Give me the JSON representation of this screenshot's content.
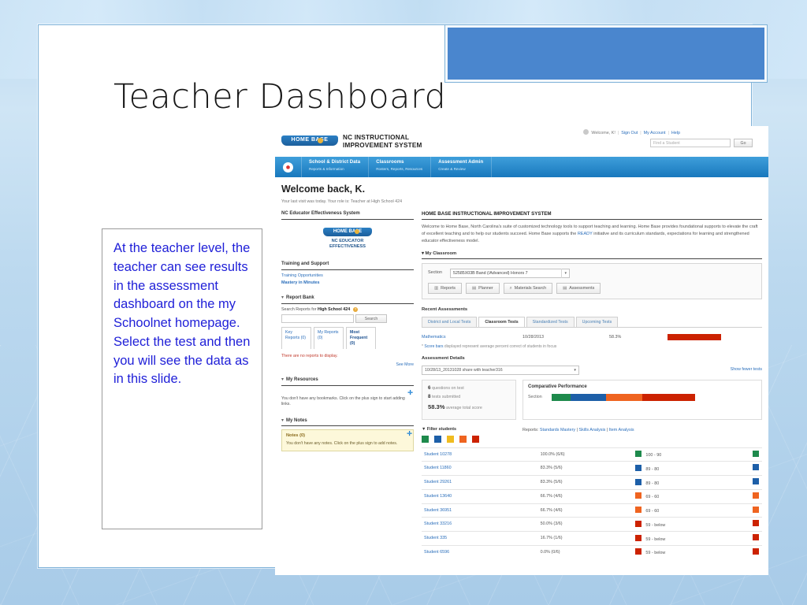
{
  "slide": {
    "title": "Teacher Dashboard",
    "caption": "At the teacher level, the teacher can see results in the assessment dashboard on the my Schoolnet homepage.\nSelect the test and then you will see the data as in this slide."
  },
  "app": {
    "brand": {
      "logo_text": "HOME BASE",
      "title_line1": "NC INSTRUCTIONAL",
      "title_line2": "IMPROVEMENT SYSTEM"
    },
    "userbar": {
      "welcome": "Welcome, K!",
      "sign_out": "Sign Out",
      "my_account": "My Account",
      "help": "Help"
    },
    "find_student": {
      "placeholder": "Find a Student",
      "go_label": "Go"
    },
    "nav": [
      {
        "title": "School & District Data",
        "subtitle": "Reports & Information"
      },
      {
        "title": "Classrooms",
        "subtitle": "Rosters, Reports, Resources"
      },
      {
        "title": "Assessment Admin",
        "subtitle": "Create & Review"
      }
    ],
    "welcome": {
      "heading": "Welcome back, K.",
      "subtext": "Your last visit was today. Your role is: Teacher at High School 424"
    },
    "left": {
      "ee_header": "NC Educator Effectiveness System",
      "ee_logo": "HOME BASE",
      "ee_sub_line1": "NC EDUCATOR",
      "ee_sub_line2": "EFFECTIVENESS",
      "training_header": "Training and Support",
      "training_links": [
        "Training Opportunities",
        "Mastery in Minutes"
      ],
      "report_bank": {
        "header": "Report Bank",
        "search_label_prefix": "Search Reports for ",
        "search_label_school": "High School 424",
        "search_button": "Search",
        "tabs": [
          "Key Reports (0)",
          "My Reports (0)",
          "Most Frequent (0)"
        ],
        "empty_message": "There are no reports to display.",
        "see_more": "See More"
      },
      "my_resources": {
        "header": "My Resources",
        "body": "You don't have any bookmarks. Click on the plus sign to start adding links."
      },
      "my_notes": {
        "header": "My Notes",
        "card_title": "Notes (0)",
        "card_body": "You don't have any notes. Click on the plus sign to add notes."
      }
    },
    "right": {
      "intro_header": "HOME BASE INSTRUCTIONAL IMPROVEMENT SYSTEM",
      "intro_body_1": "Welcome to Home Base, North Carolina's suite of customized technology tools to support teaching and learning. Home Base provides foundational supports to elevate the craft of excellent teaching and to help our students succeed. Home Base supports the ",
      "intro_link_1": "READY",
      "intro_body_2": " initiative and its curriculum standards, expectations for learning and strengthened educator effectiveness model.",
      "my_classroom": {
        "header": "My Classroom",
        "section_label": "Section",
        "section_value": "52585X03B Band (/Advanced) Honors 7",
        "buttons": [
          "Reports",
          "Planner",
          "Materials Search",
          "Assessments"
        ]
      },
      "recent_assessments": {
        "header": "Recent Assessments",
        "tabs": [
          "District and Local Tests",
          "Classroom Tests",
          "Standardized Tests",
          "Upcoming Tests"
        ],
        "active_tab": "Classroom Tests",
        "row": {
          "subject": "Mathematics",
          "date": "10/28/2013",
          "score": "58.3%",
          "bar_color": "#cc2200"
        },
        "footnote_star": "* ",
        "footnote_link": "Score bars",
        "footnote_rest": " displayed represent average percent correct of students in focus"
      },
      "assessment_details": {
        "header": "Assessment Details",
        "select_value": "10/28/13_20131028 share with teacher316",
        "show_fewer": "Show fewer tests",
        "stats": [
          {
            "value": "6",
            "label": "questions on test"
          },
          {
            "value": "8",
            "label": "tests submitted"
          },
          {
            "value": "58.3%",
            "label": "average total score"
          }
        ],
        "comparative": {
          "header": "Comparative Performance",
          "row_label": "Section",
          "segments": [
            {
              "color": "#1e8a4c",
              "pct": 13
            },
            {
              "color": "#1d5fa8",
              "pct": 25
            },
            {
              "color": "#ef6420",
              "pct": 25
            },
            {
              "color": "#cc2200",
              "pct": 37
            }
          ]
        }
      },
      "filter": {
        "label": "Filter students",
        "swatches": [
          "#1e8a4c",
          "#1d5fa8",
          "#f0bc20",
          "#ef6420",
          "#cc2200"
        ],
        "reports_label": "Reports: ",
        "reports_links": [
          "Standards Mastery",
          "Skills Analysis",
          "Item Analysis"
        ]
      },
      "students": [
        {
          "name": "Student 10278",
          "pct": "100.0% (6/6)",
          "band": "100 - 90",
          "color": "#1e8a4c"
        },
        {
          "name": "Student 11860",
          "pct": "83.3% (5/6)",
          "band": "89 - 80",
          "color": "#1d5fa8"
        },
        {
          "name": "Student 29261",
          "pct": "83.3% (5/6)",
          "band": "89 - 80",
          "color": "#1d5fa8"
        },
        {
          "name": "Student 13640",
          "pct": "66.7% (4/6)",
          "band": "69 - 60",
          "color": "#ef6420"
        },
        {
          "name": "Student 36951",
          "pct": "66.7% (4/6)",
          "band": "69 - 60",
          "color": "#ef6420"
        },
        {
          "name": "Student 33216",
          "pct": "50.0% (3/6)",
          "band": "59 - below",
          "color": "#cc2200"
        },
        {
          "name": "Student 335",
          "pct": "16.7% (1/6)",
          "band": "59 - below",
          "color": "#cc2200"
        },
        {
          "name": "Student 6596",
          "pct": "0.0% (0/6)",
          "band": "59 - below",
          "color": "#cc2200"
        }
      ]
    }
  }
}
